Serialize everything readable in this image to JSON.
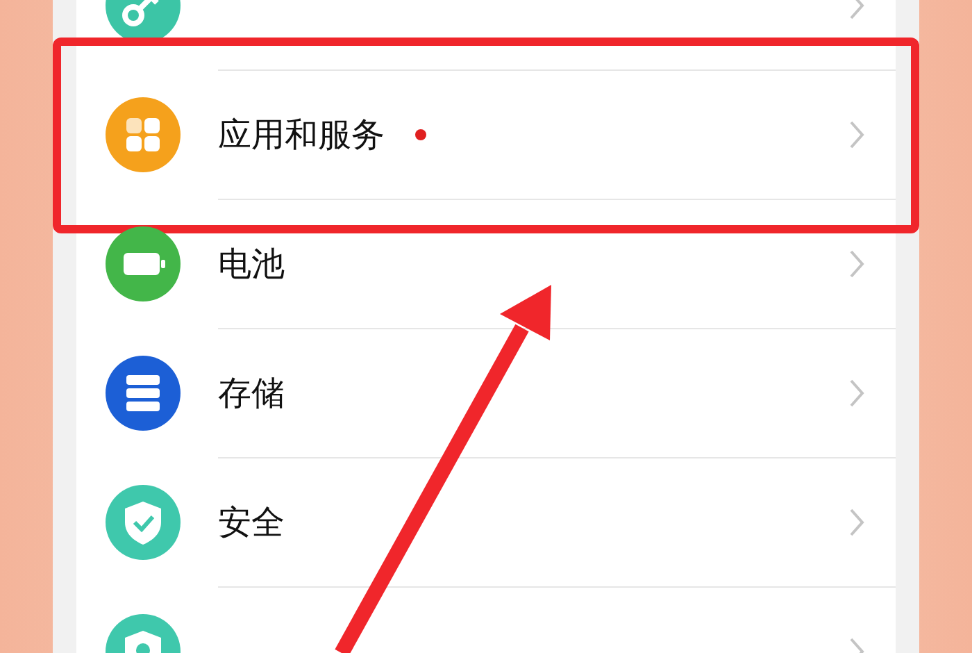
{
  "settings": [
    {
      "kind": "key",
      "color": "#3cc5a6",
      "dot": false,
      "highlighted": false
    },
    {
      "label": "应用和服务",
      "kind": "apps",
      "color": "#f5a11c",
      "dot": true,
      "highlighted": true
    },
    {
      "label": "电池",
      "kind": "battery",
      "color": "#43b649",
      "dot": false,
      "highlighted": false
    },
    {
      "label": "存储",
      "kind": "storage",
      "color": "#1c5fd6",
      "dot": false,
      "highlighted": false
    },
    {
      "label": "安全",
      "kind": "shield",
      "color": "#3fc8ac",
      "dot": false,
      "highlighted": false
    },
    {
      "kind": "privacy",
      "color": "#3fc8ac",
      "dot": false,
      "highlighted": false
    }
  ]
}
